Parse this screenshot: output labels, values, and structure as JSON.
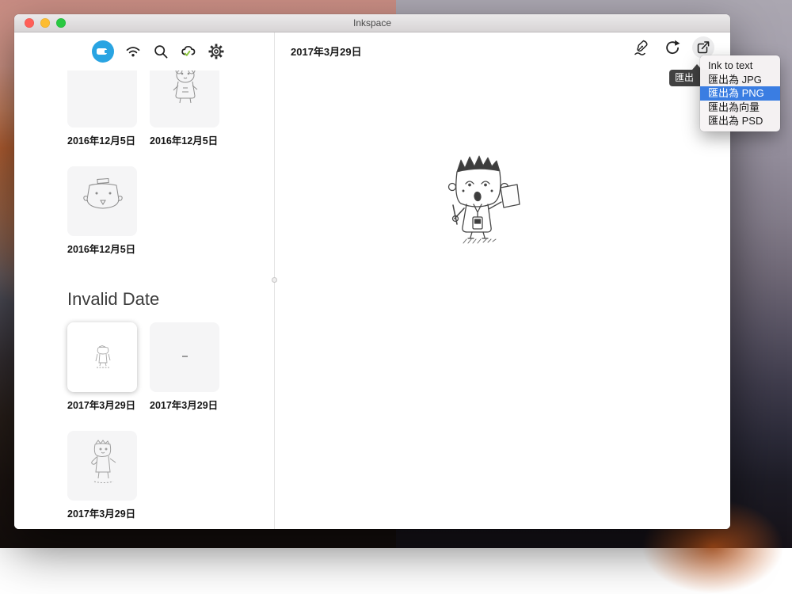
{
  "window": {
    "title": "Inkspace"
  },
  "sidebar": {
    "section_header": "Invalid Date",
    "items": [
      {
        "date": "2016年12月5日"
      },
      {
        "date": "2016年12月5日"
      },
      {
        "date": "2016年12月5日"
      },
      {
        "date": "2017年3月29日"
      },
      {
        "date": "2017年3月29日"
      },
      {
        "date": "2017年3月29日"
      }
    ]
  },
  "main": {
    "date_heading": "2017年3月29日"
  },
  "tooltip": {
    "label": "匯出"
  },
  "export_menu": {
    "items": [
      {
        "label": "Ink to text"
      },
      {
        "label": "匯出為 JPG"
      },
      {
        "label": "匯出為 PNG"
      },
      {
        "label": "匯出為向量"
      },
      {
        "label": "匯出為 PSD"
      }
    ]
  },
  "colors": {
    "accent_blue": "#29a4e2",
    "menu_selection_blue": "#3a7de2",
    "cloud_check_green": "#8dc63f",
    "traffic_red": "#ff5f58",
    "traffic_yellow": "#fdbc30",
    "traffic_green": "#29c841"
  }
}
